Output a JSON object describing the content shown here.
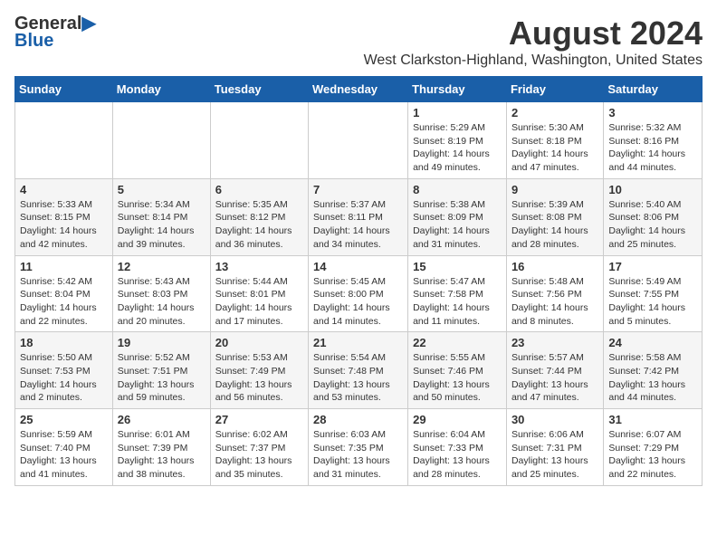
{
  "header": {
    "logo_general": "General",
    "logo_blue": "Blue",
    "month_title": "August 2024",
    "location": "West Clarkston-Highland, Washington, United States"
  },
  "days_of_week": [
    "Sunday",
    "Monday",
    "Tuesday",
    "Wednesday",
    "Thursday",
    "Friday",
    "Saturday"
  ],
  "weeks": [
    {
      "cells": [
        {
          "day": "",
          "info": ""
        },
        {
          "day": "",
          "info": ""
        },
        {
          "day": "",
          "info": ""
        },
        {
          "day": "",
          "info": ""
        },
        {
          "day": "1",
          "info": "Sunrise: 5:29 AM\nSunset: 8:19 PM\nDaylight: 14 hours\nand 49 minutes."
        },
        {
          "day": "2",
          "info": "Sunrise: 5:30 AM\nSunset: 8:18 PM\nDaylight: 14 hours\nand 47 minutes."
        },
        {
          "day": "3",
          "info": "Sunrise: 5:32 AM\nSunset: 8:16 PM\nDaylight: 14 hours\nand 44 minutes."
        }
      ]
    },
    {
      "cells": [
        {
          "day": "4",
          "info": "Sunrise: 5:33 AM\nSunset: 8:15 PM\nDaylight: 14 hours\nand 42 minutes."
        },
        {
          "day": "5",
          "info": "Sunrise: 5:34 AM\nSunset: 8:14 PM\nDaylight: 14 hours\nand 39 minutes."
        },
        {
          "day": "6",
          "info": "Sunrise: 5:35 AM\nSunset: 8:12 PM\nDaylight: 14 hours\nand 36 minutes."
        },
        {
          "day": "7",
          "info": "Sunrise: 5:37 AM\nSunset: 8:11 PM\nDaylight: 14 hours\nand 34 minutes."
        },
        {
          "day": "8",
          "info": "Sunrise: 5:38 AM\nSunset: 8:09 PM\nDaylight: 14 hours\nand 31 minutes."
        },
        {
          "day": "9",
          "info": "Sunrise: 5:39 AM\nSunset: 8:08 PM\nDaylight: 14 hours\nand 28 minutes."
        },
        {
          "day": "10",
          "info": "Sunrise: 5:40 AM\nSunset: 8:06 PM\nDaylight: 14 hours\nand 25 minutes."
        }
      ]
    },
    {
      "cells": [
        {
          "day": "11",
          "info": "Sunrise: 5:42 AM\nSunset: 8:04 PM\nDaylight: 14 hours\nand 22 minutes."
        },
        {
          "day": "12",
          "info": "Sunrise: 5:43 AM\nSunset: 8:03 PM\nDaylight: 14 hours\nand 20 minutes."
        },
        {
          "day": "13",
          "info": "Sunrise: 5:44 AM\nSunset: 8:01 PM\nDaylight: 14 hours\nand 17 minutes."
        },
        {
          "day": "14",
          "info": "Sunrise: 5:45 AM\nSunset: 8:00 PM\nDaylight: 14 hours\nand 14 minutes."
        },
        {
          "day": "15",
          "info": "Sunrise: 5:47 AM\nSunset: 7:58 PM\nDaylight: 14 hours\nand 11 minutes."
        },
        {
          "day": "16",
          "info": "Sunrise: 5:48 AM\nSunset: 7:56 PM\nDaylight: 14 hours\nand 8 minutes."
        },
        {
          "day": "17",
          "info": "Sunrise: 5:49 AM\nSunset: 7:55 PM\nDaylight: 14 hours\nand 5 minutes."
        }
      ]
    },
    {
      "cells": [
        {
          "day": "18",
          "info": "Sunrise: 5:50 AM\nSunset: 7:53 PM\nDaylight: 14 hours\nand 2 minutes."
        },
        {
          "day": "19",
          "info": "Sunrise: 5:52 AM\nSunset: 7:51 PM\nDaylight: 13 hours\nand 59 minutes."
        },
        {
          "day": "20",
          "info": "Sunrise: 5:53 AM\nSunset: 7:49 PM\nDaylight: 13 hours\nand 56 minutes."
        },
        {
          "day": "21",
          "info": "Sunrise: 5:54 AM\nSunset: 7:48 PM\nDaylight: 13 hours\nand 53 minutes."
        },
        {
          "day": "22",
          "info": "Sunrise: 5:55 AM\nSunset: 7:46 PM\nDaylight: 13 hours\nand 50 minutes."
        },
        {
          "day": "23",
          "info": "Sunrise: 5:57 AM\nSunset: 7:44 PM\nDaylight: 13 hours\nand 47 minutes."
        },
        {
          "day": "24",
          "info": "Sunrise: 5:58 AM\nSunset: 7:42 PM\nDaylight: 13 hours\nand 44 minutes."
        }
      ]
    },
    {
      "cells": [
        {
          "day": "25",
          "info": "Sunrise: 5:59 AM\nSunset: 7:40 PM\nDaylight: 13 hours\nand 41 minutes."
        },
        {
          "day": "26",
          "info": "Sunrise: 6:01 AM\nSunset: 7:39 PM\nDaylight: 13 hours\nand 38 minutes."
        },
        {
          "day": "27",
          "info": "Sunrise: 6:02 AM\nSunset: 7:37 PM\nDaylight: 13 hours\nand 35 minutes."
        },
        {
          "day": "28",
          "info": "Sunrise: 6:03 AM\nSunset: 7:35 PM\nDaylight: 13 hours\nand 31 minutes."
        },
        {
          "day": "29",
          "info": "Sunrise: 6:04 AM\nSunset: 7:33 PM\nDaylight: 13 hours\nand 28 minutes."
        },
        {
          "day": "30",
          "info": "Sunrise: 6:06 AM\nSunset: 7:31 PM\nDaylight: 13 hours\nand 25 minutes."
        },
        {
          "day": "31",
          "info": "Sunrise: 6:07 AM\nSunset: 7:29 PM\nDaylight: 13 hours\nand 22 minutes."
        }
      ]
    }
  ]
}
